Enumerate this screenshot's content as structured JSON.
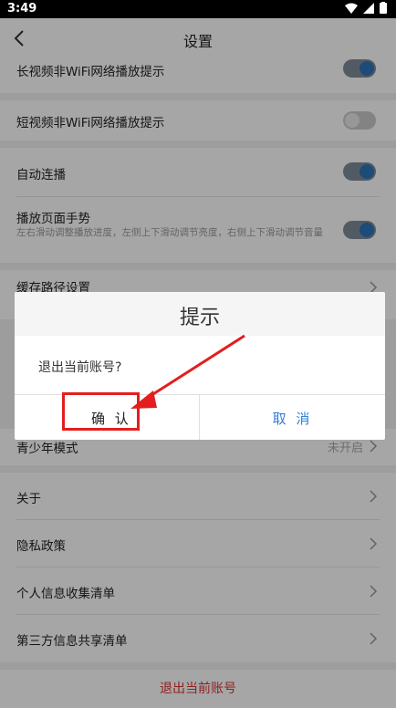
{
  "status_bar": {
    "time": "3:49"
  },
  "header": {
    "title": "设置"
  },
  "settings": {
    "long_video_wifi": {
      "label": "长视频非WiFi网络播放提示",
      "enabled": true
    },
    "short_video_wifi": {
      "label": "短视频非WiFi网络播放提示",
      "enabled": false
    },
    "autoplay": {
      "label": "自动连播",
      "enabled": true
    },
    "gesture": {
      "label": "播放页面手势",
      "desc": "左右滑动调整播放进度，左侧上下滑动调节亮度，右侧上下滑动调节音量",
      "enabled": true
    },
    "cache_path": {
      "label": "缓存路径设置"
    },
    "teen_mode": {
      "label": "青少年模式",
      "value": "未开启"
    },
    "about": {
      "label": "关于"
    },
    "privacy": {
      "label": "隐私政策"
    },
    "personal_info": {
      "label": "个人信息收集清单"
    },
    "third_party": {
      "label": "第三方信息共享清单"
    },
    "logout": {
      "label": "退出当前账号"
    }
  },
  "dialog": {
    "title": "提示",
    "message": "退出当前账号?",
    "confirm_label": "确 认",
    "cancel_label": "取 消"
  },
  "colors": {
    "accent": "#2e73b8",
    "danger": "#d33333",
    "annotation": "#e31e1e"
  }
}
